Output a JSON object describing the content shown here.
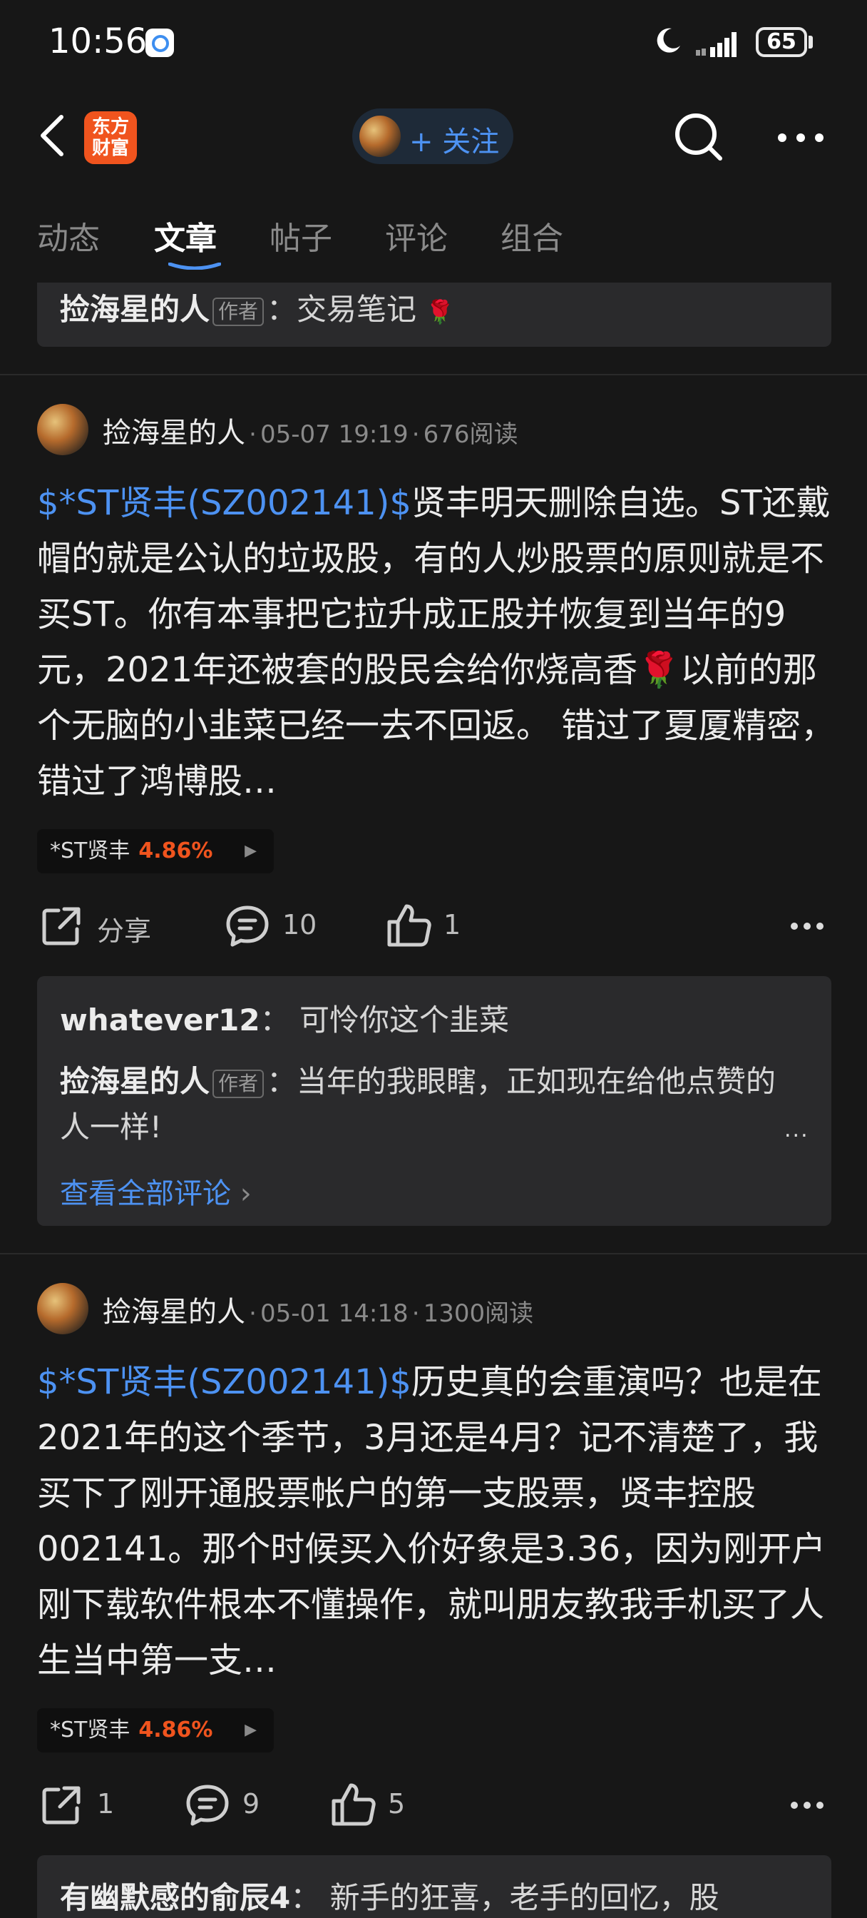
{
  "status_bar": {
    "time": "10:56",
    "battery": "65"
  },
  "header": {
    "app_logo_line1": "东方",
    "app_logo_line2": "财富",
    "follow_label": "+ 关注"
  },
  "tabs": [
    {
      "label": "动态"
    },
    {
      "label": "文章"
    },
    {
      "label": "帖子"
    },
    {
      "label": "评论"
    },
    {
      "label": "组合"
    }
  ],
  "active_tab_index": 1,
  "top_card": {
    "author": "捡海星的人",
    "author_tag": "作者",
    "separator": "：",
    "text": "交易笔记",
    "emoji": "🌹"
  },
  "posts": [
    {
      "author": "捡海星的人",
      "date": "05-07 19:19",
      "reads": "676阅读",
      "ticker": "$*ST贤丰(SZ002141)$",
      "body": "贤丰明天删除自选。ST还戴帽的就是公认的垃圾股，有的人炒股票的原则就是不买ST。你有本事把它拉升成正股并恢复到当年的9元，2021年还被套的股民会给你烧高香🌹以前的那个无脑的小韭菜已经一去不回返。 错过了夏厦精密，错过了鸿博股…",
      "stock_name": "*ST贤丰",
      "stock_change": "4.86%",
      "share_label": "分享",
      "comment_count": "10",
      "like_count": "1",
      "comments": [
        {
          "user": "whatever12",
          "separator": "：",
          "text": "可怜你这个韭菜"
        },
        {
          "user": "捡海星的人",
          "tag": "作者",
          "separator": "：",
          "text": "当年的我眼瞎，正如现在给他点赞的人一样!"
        }
      ],
      "view_all": "查看全部评论",
      "view_all_arrow": "›",
      "ellipsis": "..."
    },
    {
      "author": "捡海星的人",
      "date": "05-01 14:18",
      "reads": "1300阅读",
      "ticker": "$*ST贤丰(SZ002141)$",
      "body": "历史真的会重演吗？也是在2021年的这个季节，3月还是4月？记不清楚了，我买下了刚开通股票帐户的第一支股票，贤丰控股002141。那个时候买入价好象是3.36，因为刚开户刚下载软件根本不懂操作，就叫朋友教我手机买了人生当中第一支…",
      "stock_name": "*ST贤丰",
      "stock_change": "4.86%",
      "share_count": "1",
      "comment_count": "9",
      "like_count": "5",
      "comments": [
        {
          "user": "有幽默感的俞辰4",
          "separator": "：",
          "text": "新手的狂喜，老手的回忆，股"
        }
      ]
    }
  ],
  "meta_separator": "·",
  "colors": {
    "background": "#171717",
    "accent_blue": "#4d92f2",
    "rise_orange": "#f0541e",
    "card": "#2a2a2c"
  },
  "icons": [
    "back-arrow-icon",
    "search-icon",
    "more-icon",
    "share-icon",
    "comment-icon",
    "like-icon",
    "moon-icon",
    "signal-icon",
    "battery-icon"
  ]
}
